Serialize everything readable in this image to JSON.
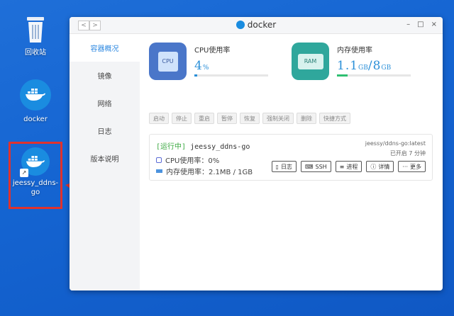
{
  "desktop": {
    "icons": [
      {
        "label": "回收站"
      },
      {
        "label": "docker"
      },
      {
        "label": "jeessy_ddns-go"
      }
    ]
  },
  "window": {
    "title": "docker",
    "nav_back": "<",
    "nav_forward": ">",
    "controls": {
      "minimize": "–",
      "maximize": "□",
      "close": "×"
    }
  },
  "sidebar": {
    "items": [
      {
        "label": "容器概况",
        "active": true
      },
      {
        "label": "镜像"
      },
      {
        "label": "网络"
      },
      {
        "label": "日志"
      },
      {
        "label": "版本说明"
      }
    ]
  },
  "stats": {
    "cpu": {
      "label": "CPU使用率",
      "value": "4",
      "unit": "%",
      "percent": 4,
      "chip_text": "CPU",
      "color": "#2a8fd8"
    },
    "mem": {
      "label": "内存使用率",
      "value_used": "1.1",
      "unit_used": "GB",
      "separator": "/",
      "value_total": "8",
      "unit_total": "GB",
      "percent": 14,
      "chip_text": "RAM",
      "color": "#2fbf71"
    }
  },
  "toolbar": {
    "buttons": [
      "启动",
      "停止",
      "重启",
      "暂停",
      "恢复",
      "强制关闭",
      "删除",
      "快捷方式"
    ]
  },
  "container": {
    "status": "[运行中]",
    "name": "jeessy_ddns-go",
    "image": "jeessy/ddns-go:latest",
    "uptime": "已开启 7 分钟",
    "cpu_line": "CPU使用率：0%",
    "mem_line": "内存使用率：2.1MB / 1GB",
    "actions": [
      {
        "icon": "log-icon",
        "glyph": "▯",
        "label": "日志"
      },
      {
        "icon": "ssh-icon",
        "glyph": "⌨",
        "label": "SSH"
      },
      {
        "icon": "process-icon",
        "glyph": "≡",
        "label": "进程"
      },
      {
        "icon": "info-icon",
        "glyph": "ⓘ",
        "label": "详情"
      },
      {
        "icon": "more-icon",
        "glyph": "···",
        "label": "更多"
      }
    ]
  },
  "colors": {
    "accent": "#2b87e0",
    "highlight_box": "#e0322d",
    "running": "#3aa840"
  }
}
